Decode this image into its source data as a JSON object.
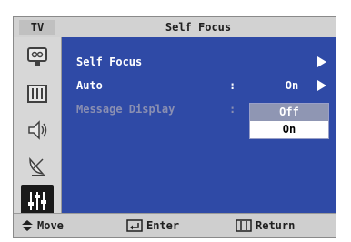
{
  "header": {
    "source_label": "TV",
    "title": "Self Focus"
  },
  "sidebar": {
    "items": [
      {
        "icon": "picture-icon"
      },
      {
        "icon": "channel-list-icon"
      },
      {
        "icon": "sound-icon"
      },
      {
        "icon": "antenna-icon"
      },
      {
        "icon": "setup-sliders-icon",
        "active": true
      }
    ]
  },
  "menu": {
    "rows": [
      {
        "label": "Self Focus"
      },
      {
        "label": "Auto",
        "colon": ":",
        "value": "On"
      },
      {
        "label": "Message Display",
        "colon": ":"
      }
    ],
    "dropdown_options": [
      {
        "label": "Off",
        "selected": true
      },
      {
        "label": "On",
        "selected": false
      }
    ]
  },
  "footer": {
    "move_label": "Move",
    "enter_label": "Enter",
    "return_label": "Return"
  },
  "colors": {
    "panel_blue": "#2f4aa6",
    "frame_grey": "#c8c8c8",
    "selected_option": "#8f96b3"
  }
}
